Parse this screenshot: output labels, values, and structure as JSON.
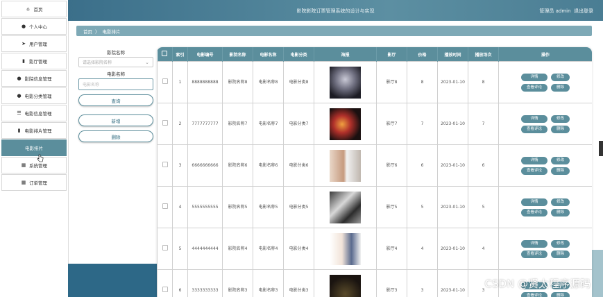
{
  "header": {
    "title": "影院影院订票管理系统的设计与实现",
    "role": "管理员 admin",
    "logout": "退出登录"
  },
  "sidebar": {
    "items": [
      {
        "icon": "home-icon",
        "label": "首页"
      },
      {
        "icon": "user-icon",
        "label": "个人中心"
      },
      {
        "icon": "send-icon",
        "label": "用户管理"
      },
      {
        "icon": "building-icon",
        "label": "影厅管理"
      },
      {
        "icon": "person-icon",
        "label": "影院信息管理"
      },
      {
        "icon": "person-icon",
        "label": "电影分类管理"
      },
      {
        "icon": "sliders-icon",
        "label": "电影信息管理"
      },
      {
        "icon": "bar-chart-icon",
        "label": "电影排片管理"
      },
      {
        "icon": "",
        "label": "电影排片"
      },
      {
        "icon": "grid-icon",
        "label": "系统管理"
      },
      {
        "icon": "grid-icon",
        "label": "订单管理"
      }
    ]
  },
  "breadcrumb": {
    "home": "首页",
    "sep": "〉",
    "current": "电影排片"
  },
  "search": {
    "cinema_label": "影院名称",
    "cinema_placeholder": "请选择影院名称",
    "movie_label": "电影名称",
    "movie_placeholder": "电影名称",
    "query_btn": "查询",
    "add_btn": "新增",
    "delete_btn": "删除"
  },
  "table": {
    "headers": [
      "",
      "索引",
      "电影编号",
      "影院名称",
      "电影名称",
      "电影分类",
      "海报",
      "影厅",
      "价格",
      "播放时间",
      "播放场次",
      "操作"
    ],
    "rows": [
      {
        "index": "1",
        "code": "8888888888",
        "cinema": "影院名称8",
        "movie": "电影名称8",
        "category": "电影分类8",
        "hall": "影厅8",
        "price": "8",
        "time": "2023-01-10",
        "session": "8"
      },
      {
        "index": "2",
        "code": "7777777777",
        "cinema": "影院名称7",
        "movie": "电影名称7",
        "category": "电影分类7",
        "hall": "影厅7",
        "price": "7",
        "time": "2023-01-10",
        "session": "7"
      },
      {
        "index": "3",
        "code": "6666666666",
        "cinema": "影院名称6",
        "movie": "电影名称6",
        "category": "电影分类6",
        "hall": "影厅6",
        "price": "6",
        "time": "2023-01-10",
        "session": "6"
      },
      {
        "index": "4",
        "code": "5555555555",
        "cinema": "影院名称5",
        "movie": "电影名称5",
        "category": "电影分类5",
        "hall": "影厅5",
        "price": "5",
        "time": "2023-01-10",
        "session": "5"
      },
      {
        "index": "5",
        "code": "4444444444",
        "cinema": "影院名称4",
        "movie": "电影名称4",
        "category": "电影分类4",
        "hall": "影厅4",
        "price": "4",
        "time": "2023-01-10",
        "session": "4"
      },
      {
        "index": "6",
        "code": "3333333333",
        "cinema": "影院名称3",
        "movie": "电影名称3",
        "category": "电影分类3",
        "hall": "影厅3",
        "price": "3",
        "time": "2023-01-10",
        "session": "3"
      }
    ],
    "actions": {
      "detail": "详情",
      "edit": "修改",
      "comments": "查看评论",
      "delete": "删除"
    }
  },
  "watermark": "CSDN @贤太程序源码"
}
